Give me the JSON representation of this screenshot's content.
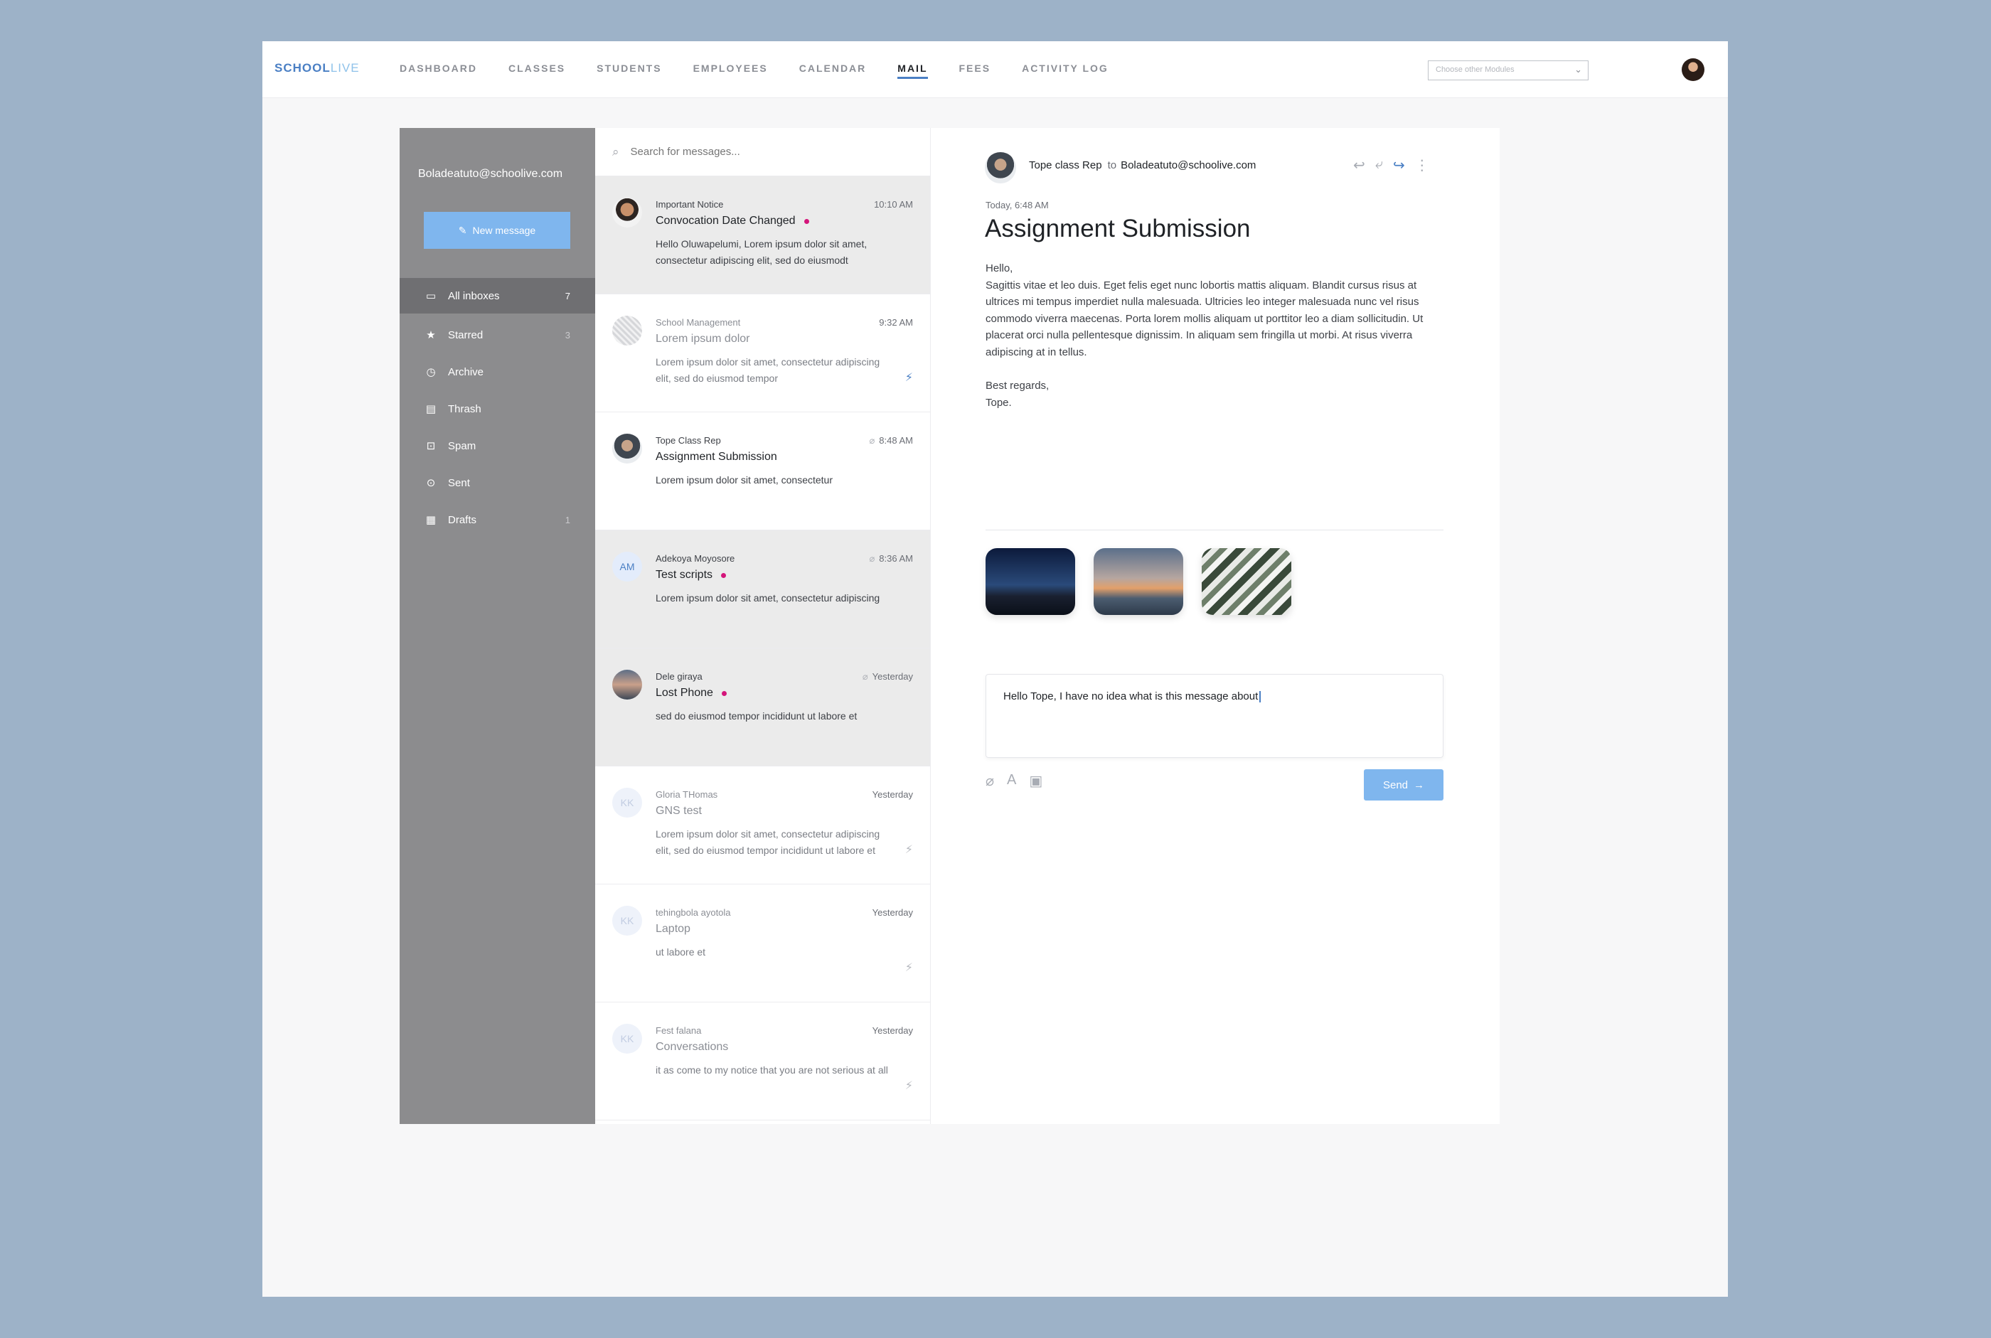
{
  "app": {
    "logo_a": "SCHOOL",
    "logo_b": "LIVE"
  },
  "nav": [
    {
      "label": "DASHBOARD",
      "active": false
    },
    {
      "label": "CLASSES",
      "active": false
    },
    {
      "label": "STUDENTS",
      "active": false
    },
    {
      "label": "EMPLOYEES",
      "active": false
    },
    {
      "label": "CALENDAR",
      "active": false
    },
    {
      "label": "MAIL",
      "active": true
    },
    {
      "label": "FEES",
      "active": false
    },
    {
      "label": "ACTIVITY LOG",
      "active": false
    }
  ],
  "module_select": {
    "placeholder": "Choose other Modules"
  },
  "sidebar": {
    "account": "Boladeatuto@schoolive.com",
    "new_message": "New message",
    "folders": [
      {
        "label": "All inboxes",
        "count": "7",
        "icon": "inbox-icon",
        "active": true
      },
      {
        "label": "Starred",
        "count": "3",
        "icon": "star-icon"
      },
      {
        "label": "Archive",
        "count": "",
        "icon": "clock-icon"
      },
      {
        "label": "Thrash",
        "count": "",
        "icon": "trash-icon"
      },
      {
        "label": "Spam",
        "count": "",
        "icon": "spam-icon"
      },
      {
        "label": "Sent",
        "count": "",
        "icon": "check-circle-icon"
      },
      {
        "label": "Drafts",
        "count": "1",
        "icon": "drafts-icon"
      }
    ]
  },
  "search": {
    "placeholder": "Search for messages..."
  },
  "messages": [
    {
      "sender": "Important Notice",
      "time": "10:10 AM",
      "subject": "Convocation Date Changed",
      "snippet": "Hello Oluwapelumi, Lorem ipsum dolor sit amet, consectetur adipiscing elit, sed do eiusmodt",
      "unread": true
    },
    {
      "sender": "School Management",
      "time": "9:32 AM",
      "subject": "Lorem ipsum dolor",
      "snippet": "Lorem ipsum dolor sit amet, consectetur adipiscing elit, sed do eiusmod tempor",
      "unread": false
    },
    {
      "sender": "Tope Class Rep",
      "time": "8:48 AM",
      "subject": "Assignment Submission",
      "snippet": "Lorem ipsum dolor sit amet, consectetur",
      "selected": true
    },
    {
      "sender": "Adekoya Moyosore",
      "time": "8:36 AM",
      "subject": "Test scripts",
      "snippet": "Lorem ipsum dolor sit amet, consectetur adipiscing",
      "unread": true,
      "initials": "AM"
    },
    {
      "sender": "Dele giraya",
      "time": "Yesterday",
      "subject": "Lost Phone",
      "snippet": "sed do eiusmod tempor incididunt ut labore et",
      "unread": true
    },
    {
      "sender": "Gloria THomas",
      "time": "Yesterday",
      "subject": "GNS test",
      "snippet": "Lorem ipsum dolor sit amet, consectetur adipiscing elit, sed do eiusmod tempor incididunt ut labore et",
      "unread": false,
      "initials": "KK"
    },
    {
      "sender": "tehingbola ayotola",
      "time": "Yesterday",
      "subject": "Laptop",
      "snippet": "ut labore et",
      "unread": false,
      "initials": "KK"
    },
    {
      "sender": "Fest falana",
      "time": "Yesterday",
      "subject": "Conversations",
      "snippet": "it as come to my notice that you are not serious at all",
      "unread": false,
      "initials": "KK"
    }
  ],
  "reader": {
    "from": "Tope class Rep",
    "to_label": "to",
    "to": "Boladeatuto@schoolive.com",
    "date": "Today, 6:48 AM",
    "title": "Assignment Submission",
    "greeting": "Hello,",
    "body": "Sagittis vitae et leo duis. Eget felis eget nunc lobortis mattis aliquam. Blandit cursus risus at ultrices mi tempus imperdiet nulla malesuada. Ultricies leo integer malesuada nunc vel risus commodo viverra maecenas. Porta lorem mollis aliquam ut porttitor leo a diam sollicitudin. Ut placerat orci nulla pellentesque dignissim. In aliquam sem fringilla ut morbi. At risus viverra adipiscing at in tellus.",
    "signoff": "Best regards,",
    "signature": "Tope.",
    "reply_text": "Hello Tope, I have no idea what is this message about",
    "send_label": "Send"
  }
}
